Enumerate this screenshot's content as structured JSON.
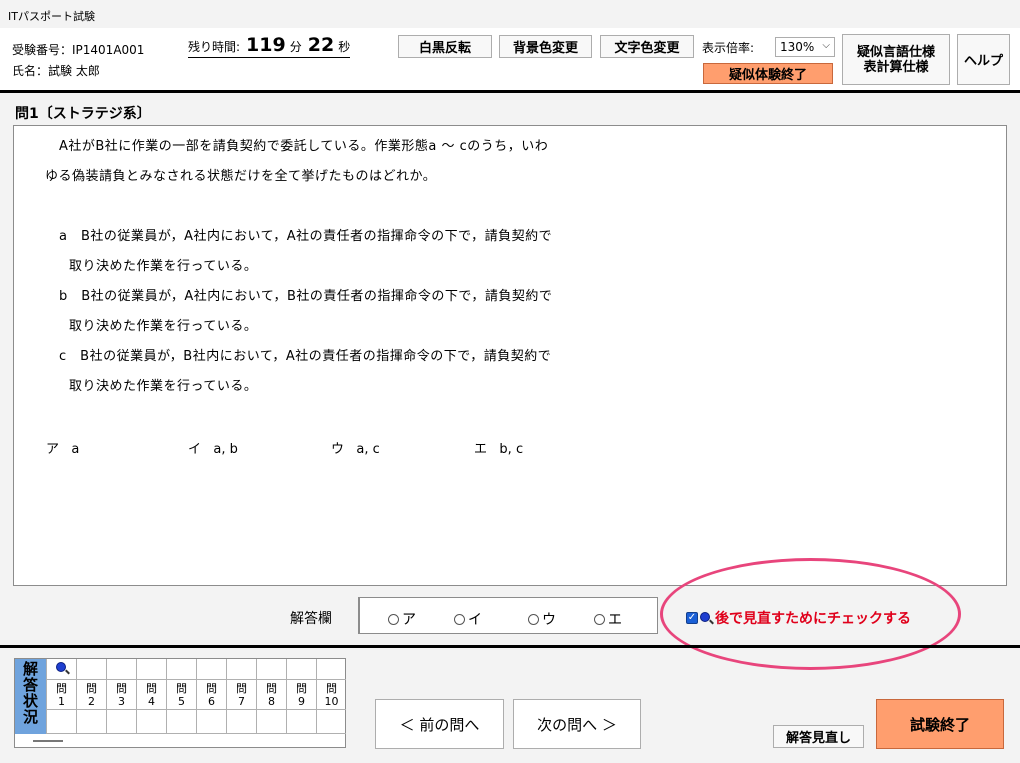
{
  "window": {
    "title": "ITパスポート試験"
  },
  "header": {
    "exam_number": "受験番号：IP1401A001",
    "name": "氏名：試験 太郎",
    "timer": {
      "label": "残り時間:",
      "minutes": "119",
      "min_unit": "分",
      "seconds": "22",
      "sec_unit": "秒"
    },
    "invert_button": "白黒反転",
    "bg_color_button": "背景色変更",
    "text_color_button": "文字色変更",
    "zoom_label": "表示倍率:",
    "zoom_value": "130%",
    "end_sim_button": "疑似体験終了",
    "spec_button_line1": "疑似言語仕様",
    "spec_button_line2": "表計算仕様",
    "help_button": "ヘルプ"
  },
  "question": {
    "title": "問1〔ストラテジ系〕",
    "lines": [
      "A社がB社に作業の一部を請負契約で委託している。作業形態a 〜 cのうち，いわ",
      "ゆる偽装請負とみなされる状態だけを全て挙げたものはどれか。",
      "a　B社の従業員が，A社内において，A社の責任者の指揮命令の下で，請負契約で",
      "取り決めた作業を行っている。",
      "b　B社の従業員が，A社内において，B社の責任者の指揮命令の下で，請負契約で",
      "取り決めた作業を行っている。",
      "c　B社の従業員が，B社内において，A社の責任者の指揮命令の下で，請負契約で",
      "取り決めた作業を行っている。"
    ],
    "options": [
      {
        "key": "ア",
        "value": "a"
      },
      {
        "key": "イ",
        "value": "a, b"
      },
      {
        "key": "ウ",
        "value": "a, c"
      },
      {
        "key": "エ",
        "value": "b, c"
      }
    ]
  },
  "answer": {
    "label": "解答欄",
    "choices": [
      "ア",
      "イ",
      "ウ",
      "エ"
    ],
    "review_checkbox_label": "後で見直すためにチェックする",
    "review_checked": true
  },
  "status_grid": {
    "header": "解答状況",
    "cells": [
      {
        "label": "問",
        "num": "1"
      },
      {
        "label": "問",
        "num": "2"
      },
      {
        "label": "問",
        "num": "3"
      },
      {
        "label": "問",
        "num": "4"
      },
      {
        "label": "問",
        "num": "5"
      },
      {
        "label": "問",
        "num": "6"
      },
      {
        "label": "問",
        "num": "7"
      },
      {
        "label": "問",
        "num": "8"
      },
      {
        "label": "問",
        "num": "9"
      },
      {
        "label": "問",
        "num": "10"
      }
    ]
  },
  "navigation": {
    "prev_button": "＜ 前の問へ",
    "next_button": "次の問へ ＞",
    "review_answers_button": "解答見直し",
    "finish_button": "試験終了"
  },
  "colors": {
    "accent_orange": "#ff9e6e",
    "grid_header_blue": "#6fa3dd",
    "review_red": "#e0001b",
    "highlight_pink": "#e8457c"
  }
}
